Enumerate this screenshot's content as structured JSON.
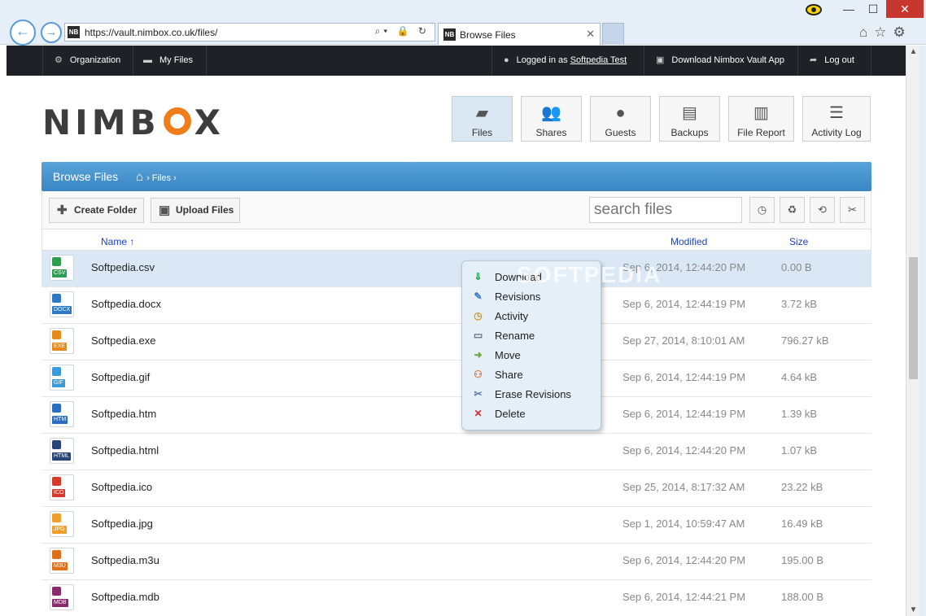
{
  "browser": {
    "url": "https://vault.nimbox.co.uk/files/",
    "tab_title": "Browse Files",
    "favicon": "NB",
    "address_tools": "⌕▾ 🔒 ↻"
  },
  "topnav": {
    "organization": "Organization",
    "my_files": "My Files",
    "logged_in_prefix": "Logged in as",
    "user": "Softpedia Test",
    "download_app": "Download Nimbox Vault App",
    "logout": "Log out"
  },
  "brand": {
    "name_pre": "NIMB",
    "name_post": "X",
    "accent": "#ef7d1a"
  },
  "modules": [
    {
      "label": "Files",
      "icon": "folder-icon"
    },
    {
      "label": "Shares",
      "icon": "users-icon"
    },
    {
      "label": "Guests",
      "icon": "user-icon"
    },
    {
      "label": "Backups",
      "icon": "archive-icon"
    },
    {
      "label": "File Report",
      "icon": "inbox-icon"
    },
    {
      "label": "Activity Log",
      "icon": "list-icon"
    }
  ],
  "browse": {
    "title": "Browse Files",
    "crumb": "Files"
  },
  "toolbar": {
    "create_folder": "Create Folder",
    "upload_files": "Upload Files",
    "search_placeholder": "search files"
  },
  "table": {
    "col_name": "Name ↑",
    "col_modified": "Modified",
    "col_size": "Size",
    "rows": [
      {
        "name": "Softpedia.csv",
        "modified": "Sep 6, 2014, 12:44:20 PM",
        "size": "0.00 B",
        "ext": "CSV",
        "color": "#2e9e4f"
      },
      {
        "name": "Softpedia.docx",
        "modified": "Sep 6, 2014, 12:44:19 PM",
        "size": "3.72 kB",
        "ext": "DOCX",
        "color": "#2a78c6"
      },
      {
        "name": "Softpedia.exe",
        "modified": "Sep 27, 2014, 8:10:01 AM",
        "size": "796.27 kB",
        "ext": "EXE",
        "color": "#e88a1a"
      },
      {
        "name": "Softpedia.gif",
        "modified": "Sep 6, 2014, 12:44:19 PM",
        "size": "4.64 kB",
        "ext": "GIF",
        "color": "#3b9ad9"
      },
      {
        "name": "Softpedia.htm",
        "modified": "Sep 6, 2014, 12:44:19 PM",
        "size": "1.39 kB",
        "ext": "HTM",
        "color": "#2a6fbf"
      },
      {
        "name": "Softpedia.html",
        "modified": "Sep 6, 2014, 12:44:20 PM",
        "size": "1.07 kB",
        "ext": "HTML",
        "color": "#28457a"
      },
      {
        "name": "Softpedia.ico",
        "modified": "Sep 25, 2014, 8:17:32 AM",
        "size": "23.22 kB",
        "ext": "ICO",
        "color": "#d33a2c"
      },
      {
        "name": "Softpedia.jpg",
        "modified": "Sep 1, 2014, 10:59:47 AM",
        "size": "16.49 kB",
        "ext": "JPG",
        "color": "#f0a02a"
      },
      {
        "name": "Softpedia.m3u",
        "modified": "Sep 6, 2014, 12:44:20 PM",
        "size": "195.00 B",
        "ext": "M3U",
        "color": "#e0701c"
      },
      {
        "name": "Softpedia.mdb",
        "modified": "Sep 6, 2014, 12:44:21 PM",
        "size": "188.00 B",
        "ext": "MDB",
        "color": "#8a2a6e"
      }
    ]
  },
  "context_menu": [
    {
      "label": "Download",
      "icon": "download-icon",
      "glyph": "⇓",
      "color": "#2e9e4f"
    },
    {
      "label": "Revisions",
      "icon": "revisions-icon",
      "glyph": "✎",
      "color": "#3a7bc8"
    },
    {
      "label": "Activity",
      "icon": "clock-icon",
      "glyph": "◷",
      "color": "#d09a1a"
    },
    {
      "label": "Rename",
      "icon": "rename-icon",
      "glyph": "▭",
      "color": "#5a6f88"
    },
    {
      "label": "Move",
      "icon": "move-icon",
      "glyph": "➜",
      "color": "#6aa83a"
    },
    {
      "label": "Share",
      "icon": "share-icon",
      "glyph": "⚇",
      "color": "#d8783a"
    },
    {
      "label": "Erase Revisions",
      "icon": "scissors-icon",
      "glyph": "✂",
      "color": "#5a78a8"
    },
    {
      "label": "Delete",
      "icon": "delete-icon",
      "glyph": "✕",
      "color": "#d22a2a"
    }
  ],
  "watermark": "SOFTPEDIA"
}
